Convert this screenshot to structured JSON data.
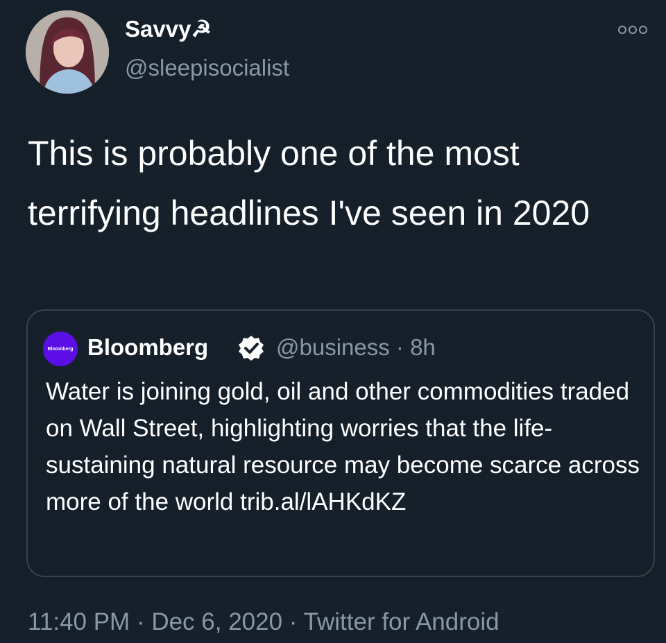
{
  "author": {
    "name": "Savvy☭",
    "handle": "@sleepisocialist"
  },
  "more_icon": "more-options-icon",
  "tweet": {
    "text": "This is probably one of the most terrifying headlines I've seen in 2020"
  },
  "quoted_tweet": {
    "avatar_text": "Bloomberg",
    "name": "Bloomberg",
    "verified_icon": "verified-badge-icon",
    "handle_time": "@business · 8h",
    "text": "Water is joining gold, oil and other commodities traded on Wall Street, highlighting worries that the life-sustaining natural resource may become scarce across more of the world trib.al/lAHKdKZ"
  },
  "meta": {
    "line": "11:40 PM · Dec 6, 2020 · Twitter for Android"
  },
  "colors": {
    "background": "#15202b",
    "secondary_text": "#8899a6",
    "border": "#38444d",
    "bloomberg_purple": "#5b0ee6"
  }
}
